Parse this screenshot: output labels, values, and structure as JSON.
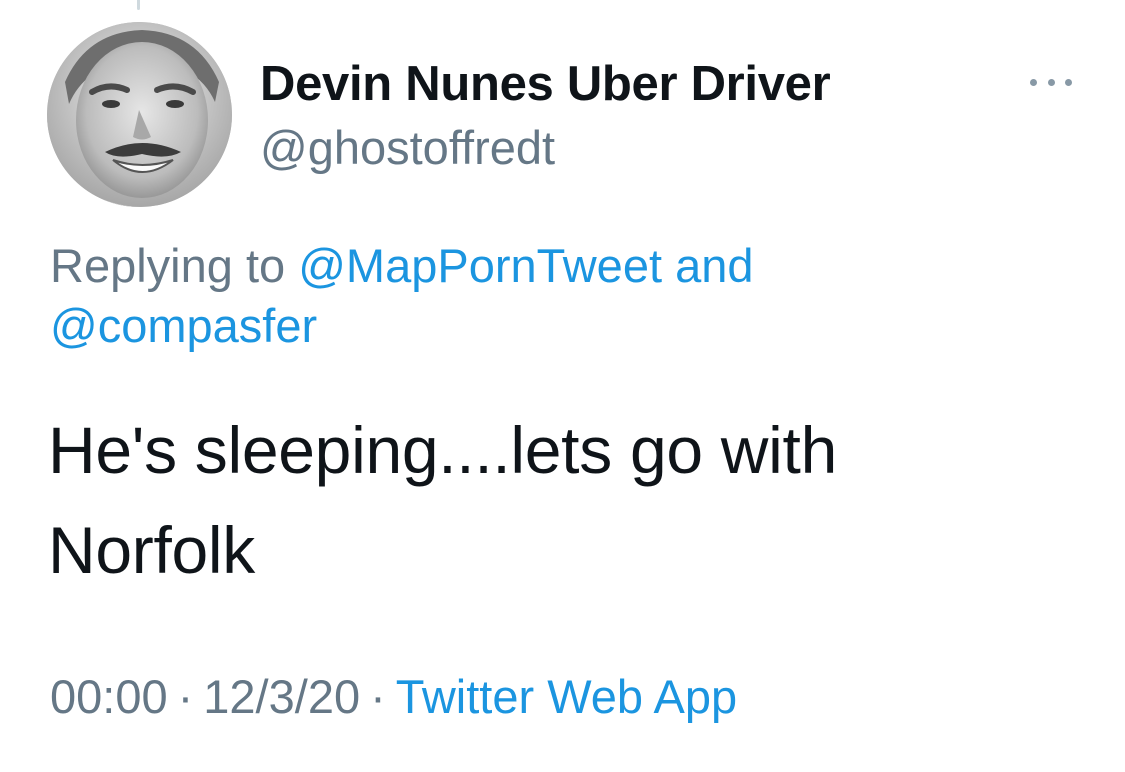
{
  "tweet": {
    "author": {
      "display_name": "Devin Nunes Uber Driver",
      "handle": "@ghostoffredt",
      "avatar_icon": "profile-photo"
    },
    "more_icon": "more-horizontal-icon",
    "reply": {
      "prefix": "Replying to",
      "user1": "@MapPornTweet",
      "conjunction": "and",
      "user2": "@compasfer"
    },
    "text_line1": "He's sleeping....lets go with",
    "text_line2": "Norfolk",
    "time": "00:00",
    "separator": "·",
    "date": "12/3/20",
    "source": "Twitter Web App"
  },
  "colors": {
    "primary_text": "#0f1419",
    "secondary_text": "#657786",
    "link": "#1b95e0",
    "icon": "#8899a6",
    "background": "#ffffff"
  }
}
